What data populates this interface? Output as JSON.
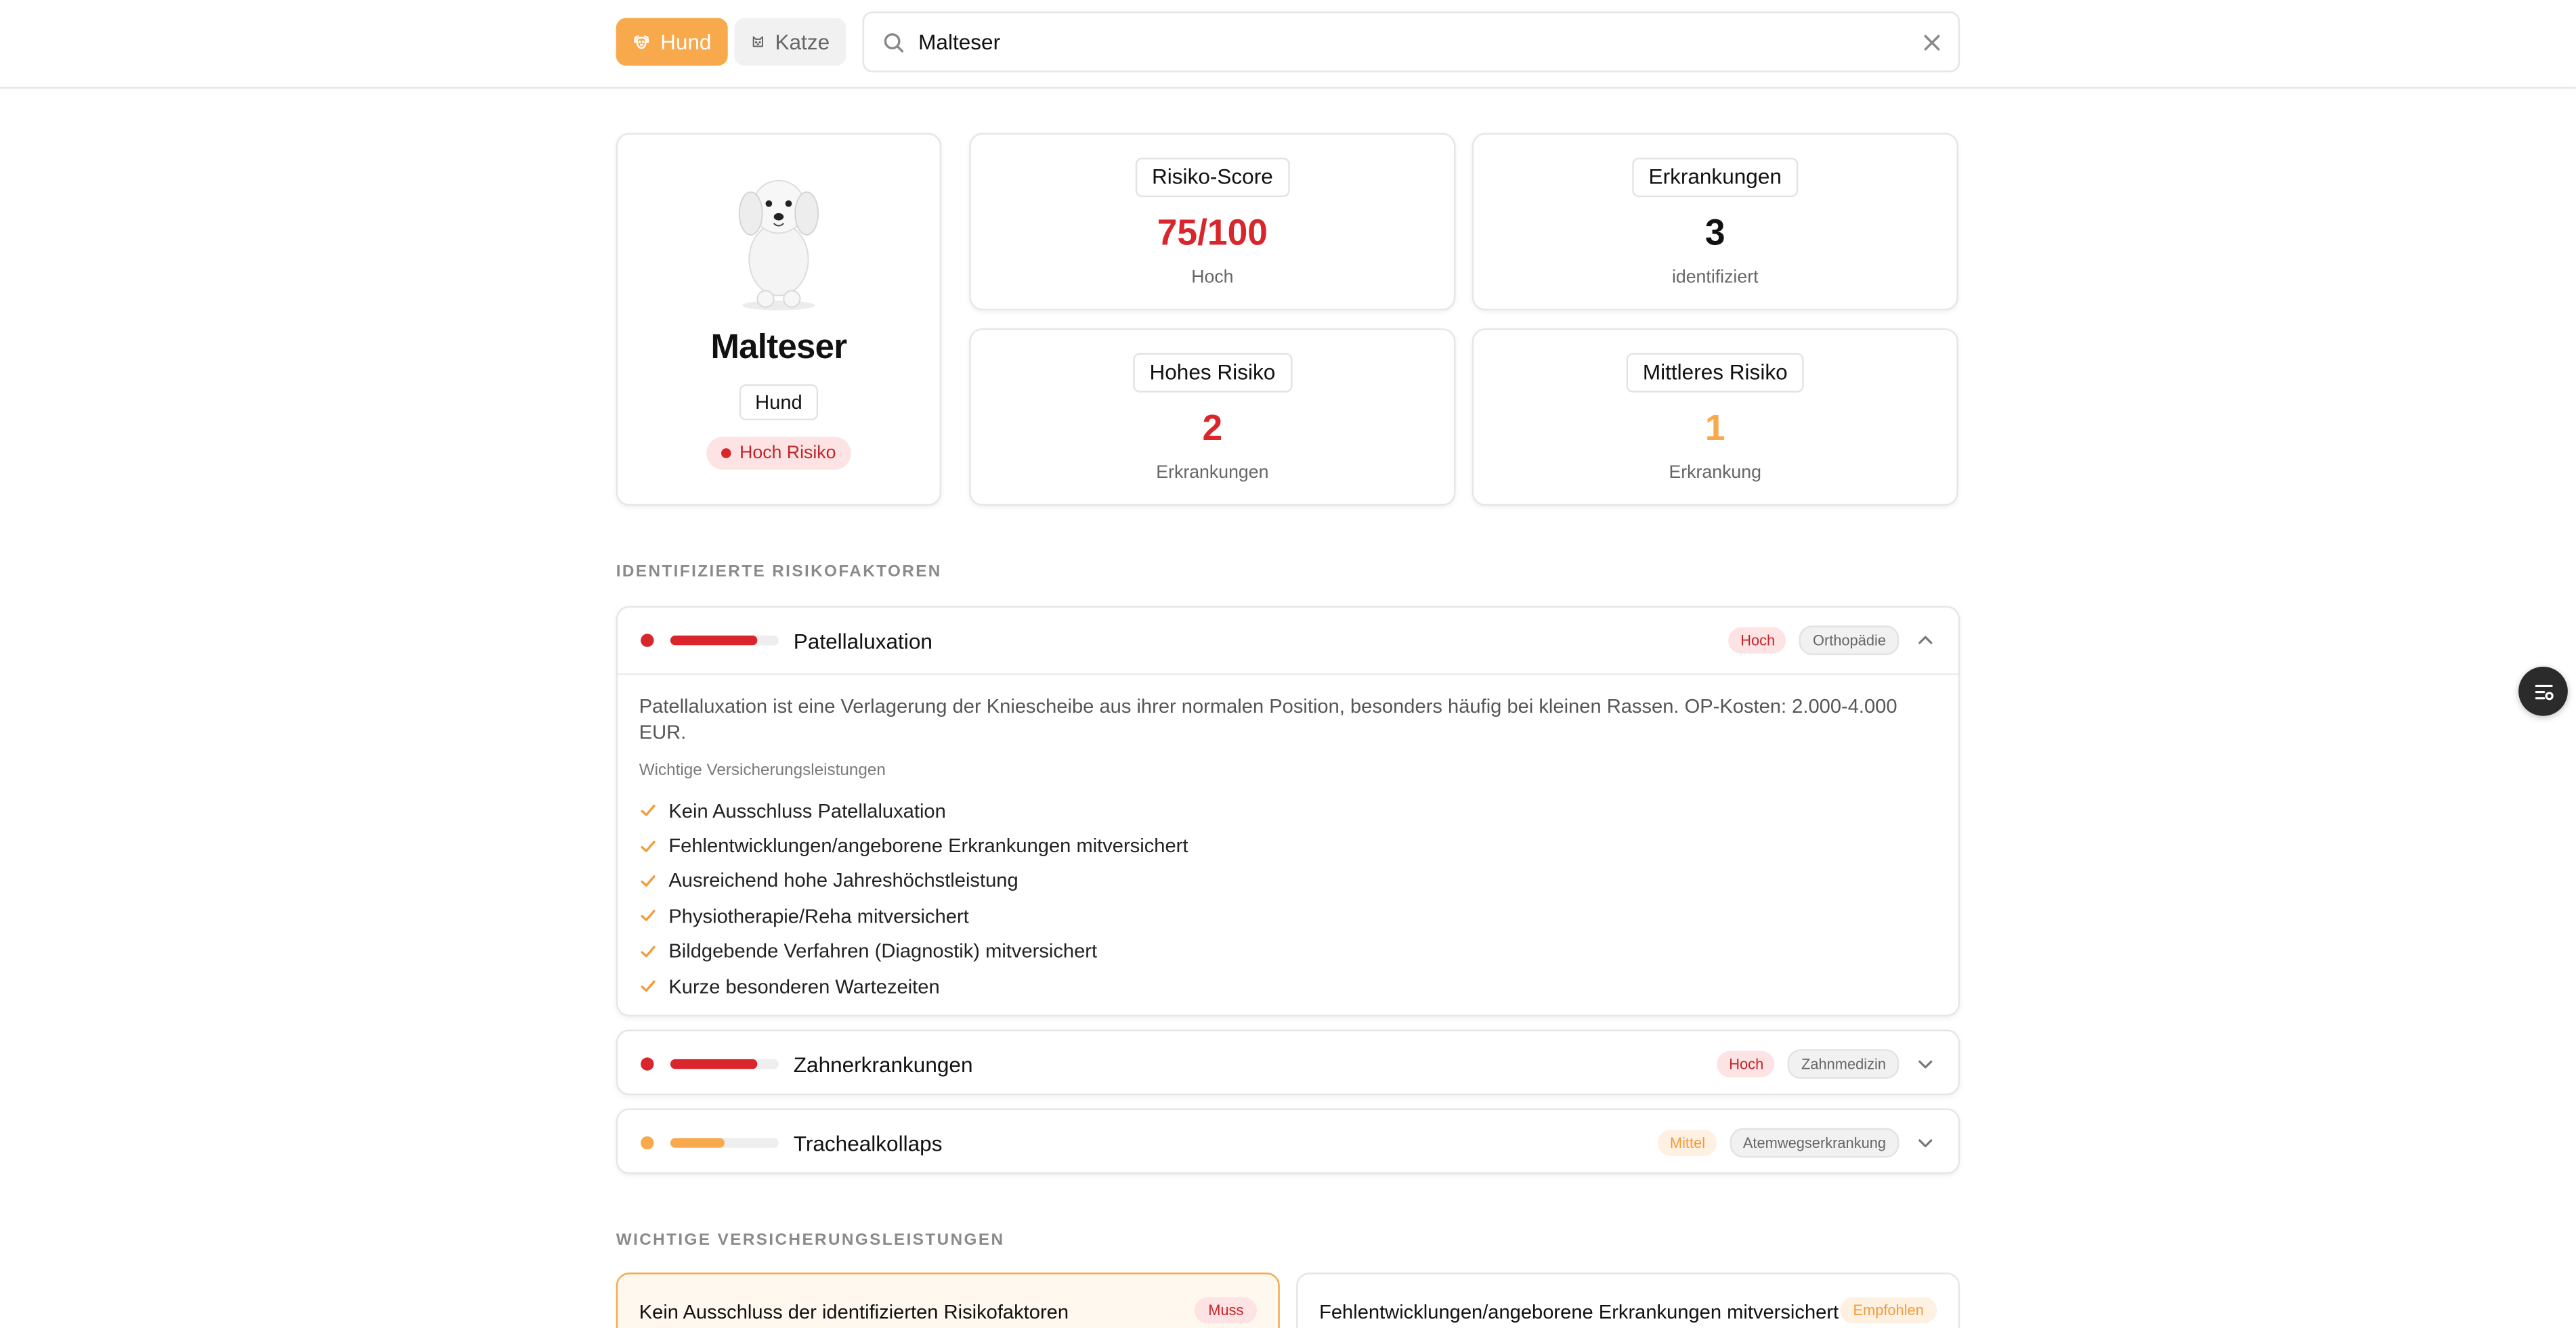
{
  "species": {
    "dog_label": "Hund",
    "cat_label": "Katze",
    "selected": "Hund",
    "active_color": "#f7a94b"
  },
  "search": {
    "value": "Malteser",
    "placeholder": ""
  },
  "profile": {
    "breed": "Malteser",
    "species": "Hund",
    "risk_label": "Hoch Risiko"
  },
  "stats": {
    "risk_score": {
      "label": "Risiko-Score",
      "value": "75/100",
      "sub": "Hoch"
    },
    "diseases": {
      "label": "Erkrankungen",
      "value": "3",
      "sub": "identifiziert"
    },
    "high_risk": {
      "label": "Hohes Risiko",
      "value": "2",
      "sub": "Erkrankungen"
    },
    "medium_risk": {
      "label": "Mittleres Risiko",
      "value": "1",
      "sub": "Erkrankung"
    }
  },
  "risk_factors": {
    "section_title": "IDENTIFIZIERTE RISIKOFAKTOREN",
    "items": [
      {
        "name": "Patellaluxation",
        "level": "Hoch",
        "category": "Orthopädie",
        "severity": 0.8,
        "color": "#d9262c",
        "expanded": true,
        "description": "Patellaluxation ist eine Verlagerung der Kniescheibe aus ihrer normalen Position, besonders häufig bei kleinen Rassen. OP-Kosten: 2.000-4.000 EUR.",
        "benefits_title": "Wichtige Versicherungsleistungen",
        "benefits": [
          "Kein Ausschluss Patellaluxation",
          "Fehlentwicklungen/angeborene Erkrankungen mitversichert",
          "Ausreichend hohe Jahreshöchstleistung",
          "Physiotherapie/Reha mitversichert",
          "Bildgebende Verfahren (Diagnostik) mitversichert",
          "Kurze besonderen Wartezeiten"
        ]
      },
      {
        "name": "Zahnerkrankungen",
        "level": "Hoch",
        "category": "Zahnmedizin",
        "severity": 0.8,
        "color": "#d9262c",
        "expanded": false
      },
      {
        "name": "Trachealkollaps",
        "level": "Mittel",
        "category": "Atemwegserkrankung",
        "severity": 0.5,
        "color": "#f7a94b",
        "expanded": false
      }
    ]
  },
  "insurance": {
    "section_title": "WICHTIGE VERSICHERUNGSLEISTUNGEN",
    "items": [
      {
        "text": "Kein Ausschluss der identifizierten Risikofaktoren",
        "tag": "Muss"
      },
      {
        "text": "Fehlentwicklungen/angeborene Erkrankungen mitversichert",
        "tag": "Empfohlen"
      }
    ]
  },
  "icons": {
    "dog": "dog-face-icon",
    "cat": "cat-face-icon",
    "search": "search-icon",
    "clear": "close-icon",
    "check": "check-icon",
    "chevron_up": "chevron-up-icon",
    "chevron_down": "chevron-down-icon",
    "floating": "list-filter-icon"
  }
}
